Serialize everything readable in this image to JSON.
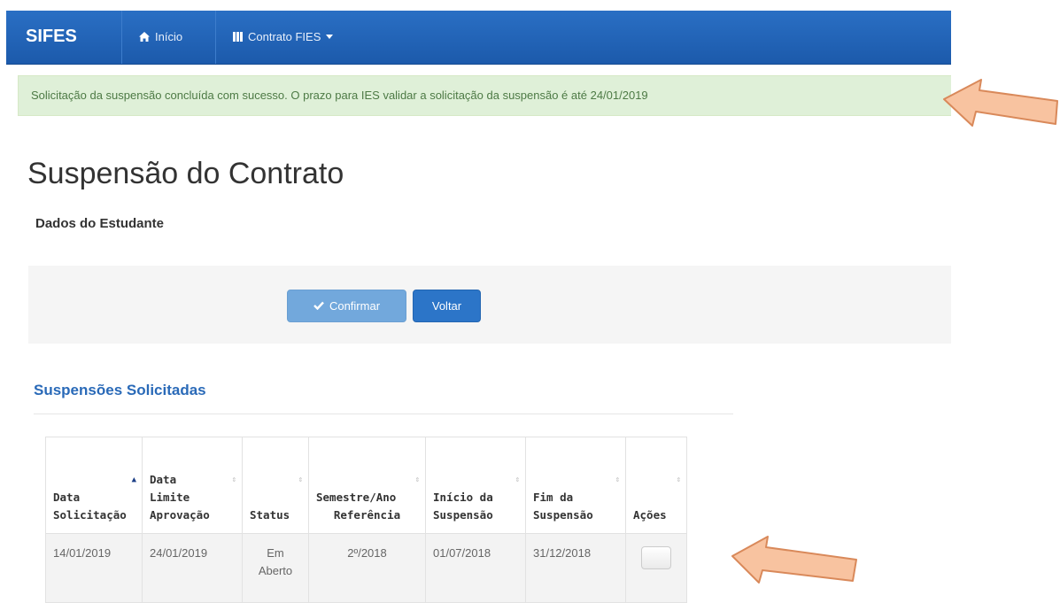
{
  "navbar": {
    "brand": "SIFES",
    "home_label": "Início",
    "contract_label": "Contrato FIES"
  },
  "alert": {
    "message": "Solicitação da suspensão concluída com sucesso. O prazo para IES validar a solicitação da suspensão é até 24/01/2019"
  },
  "page": {
    "title": "Suspensão do Contrato",
    "student_section": "Dados do Estudante"
  },
  "buttons": {
    "confirm_label": "Confirmar",
    "back_label": "Voltar"
  },
  "requests": {
    "heading": "Suspensões Solicitadas",
    "columns": [
      {
        "line1": "Data",
        "line2": "Solicitação"
      },
      {
        "line0": "Data",
        "line1": "Limite",
        "line2": "Aprovação"
      },
      {
        "line2": "Status"
      },
      {
        "line1": "Semestre/Ano",
        "line2": "Referência"
      },
      {
        "line1": "Início da",
        "line2": "Suspensão"
      },
      {
        "line1": "Fim da",
        "line2": "Suspensão"
      },
      {
        "line2": "Ações"
      }
    ],
    "rows": [
      {
        "data_solicitacao": "14/01/2019",
        "data_limite": "24/01/2019",
        "status_line1": "Em",
        "status_line2": "Aberto",
        "semestre": "2º/2018",
        "inicio": "01/07/2018",
        "fim": "31/12/2018"
      }
    ]
  },
  "colors": {
    "navbar": "#1c5aab",
    "alert_bg": "#dff0d8",
    "alert_text": "#4d7a45",
    "heading_blue": "#2a6ab8",
    "arrow_fill": "#f8c3a0",
    "arrow_stroke": "#d9895a"
  }
}
